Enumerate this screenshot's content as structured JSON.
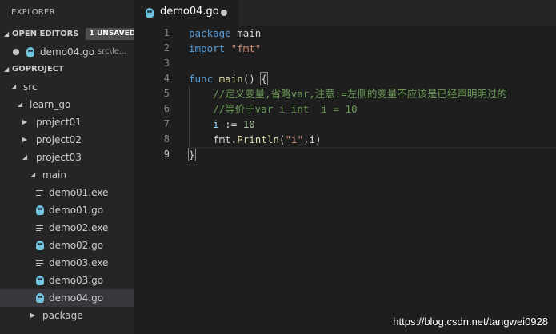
{
  "sidebar": {
    "title": "EXPLORER",
    "open_editors": {
      "label": "OPEN EDITORS",
      "badge": "1 UNSAVED",
      "items": [
        {
          "name": "demo04.go",
          "path": "src\\le..."
        }
      ]
    },
    "project": {
      "label": "GOPROJECT",
      "tree": [
        {
          "label": "src",
          "level": 0,
          "kind": "folder-open"
        },
        {
          "label": "learn_go",
          "level": 1,
          "kind": "folder-open"
        },
        {
          "label": "project01",
          "level": 2,
          "kind": "folder-closed"
        },
        {
          "label": "project02",
          "level": 2,
          "kind": "folder-closed"
        },
        {
          "label": "project03",
          "level": 2,
          "kind": "folder-open"
        },
        {
          "label": "main",
          "level": 3,
          "kind": "folder-open"
        },
        {
          "label": "demo01.exe",
          "level": 4,
          "kind": "exe"
        },
        {
          "label": "demo01.go",
          "level": 4,
          "kind": "go"
        },
        {
          "label": "demo02.exe",
          "level": 4,
          "kind": "exe"
        },
        {
          "label": "demo02.go",
          "level": 4,
          "kind": "go"
        },
        {
          "label": "demo03.exe",
          "level": 4,
          "kind": "exe"
        },
        {
          "label": "demo03.go",
          "level": 4,
          "kind": "go"
        },
        {
          "label": "demo04.go",
          "level": 4,
          "kind": "go",
          "selected": true
        },
        {
          "label": "package",
          "level": 3,
          "kind": "folder-closed"
        }
      ]
    }
  },
  "tab": {
    "name": "demo04.go"
  },
  "editor": {
    "line_numbers": [
      "1",
      "2",
      "3",
      "4",
      "5",
      "6",
      "7",
      "8",
      "9"
    ],
    "active_line": "9",
    "lines": {
      "l1_kw": "package",
      "l1_rest": " main",
      "l2_kw": "import",
      "l2_str": "\"fmt\"",
      "l4_kw": "func",
      "l4_fn": "main",
      "l4_paren": "() ",
      "l4_brace": "{",
      "l5_cm": "//定义变量,省略var,注意:=左侧的变量不应该是已经声明明过的",
      "l6_cm": "//等价于var i int  i = 10",
      "l7_var": "i",
      "l7_op": " := ",
      "l7_num": "10",
      "l8_pkg": "fmt.",
      "l8_fn": "Println",
      "l8_p1": "(",
      "l8_str": "\"i\"",
      "l8_p2": ",i)",
      "l9_brace": "}"
    }
  },
  "watermark": "https://blog.csdn.net/tangwei0928",
  "colors": {
    "keyword": "#569cd6",
    "string": "#ce9178",
    "function": "#dcdcaa",
    "comment": "#6a9955",
    "number": "#b5cea8",
    "variable": "#9cdcfe"
  }
}
